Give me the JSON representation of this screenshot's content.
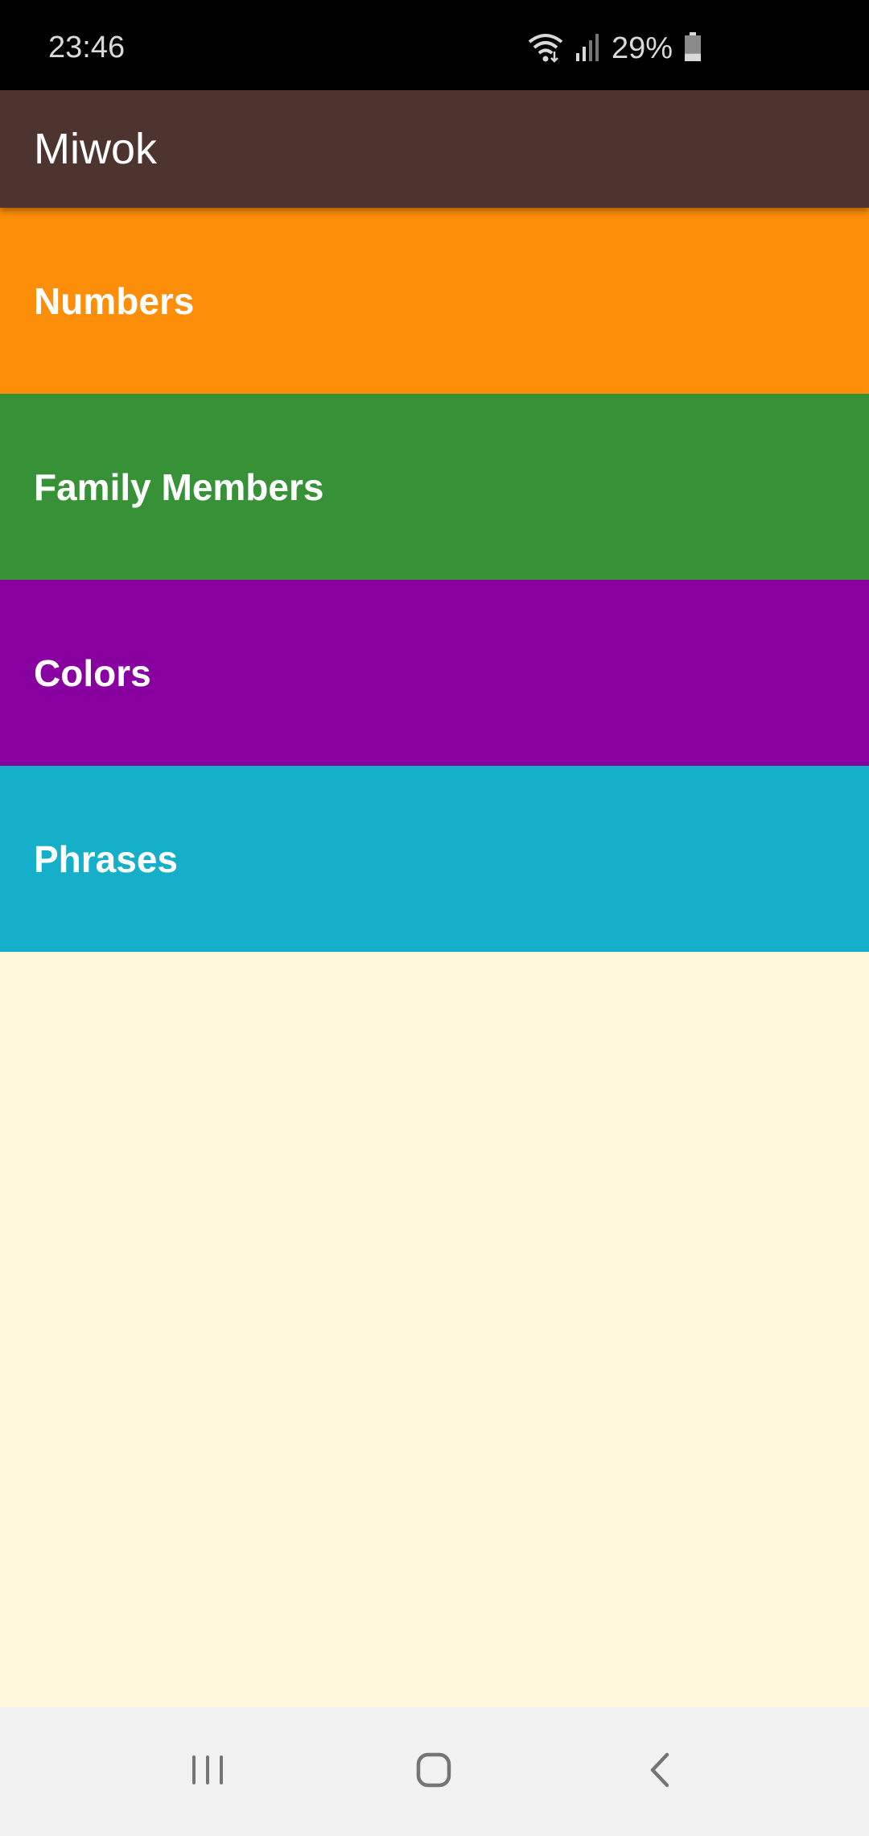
{
  "status_bar": {
    "time": "23:46",
    "battery_percent": "29%",
    "icons": [
      "wifi-icon",
      "signal-icon",
      "battery-icon"
    ],
    "battery_level": 0.29
  },
  "app_bar": {
    "title": "Miwok",
    "color": "#4E342E"
  },
  "categories": [
    {
      "label": "Numbers",
      "color": "#FD8E09"
    },
    {
      "label": "Family Members",
      "color": "#379237"
    },
    {
      "label": "Colors",
      "color": "#8800A0"
    },
    {
      "label": "Phrases",
      "color": "#16AFCA"
    }
  ],
  "background_color": "#FEF7DC",
  "nav_bar": {
    "icons": [
      "recents-icon",
      "home-icon",
      "back-icon"
    ]
  }
}
